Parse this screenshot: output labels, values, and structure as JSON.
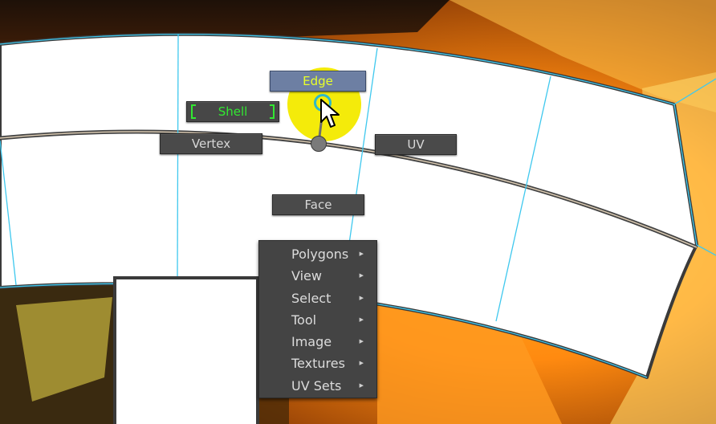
{
  "marking_menu": {
    "edge_label": "Edge",
    "shell_label": "Shell",
    "vertex_label": "Vertex",
    "uv_label": "UV",
    "face_label": "Face",
    "edge_text_color": "#e8ff2a",
    "shell_text_color": "#32e832"
  },
  "context_menu": {
    "items": [
      {
        "label": "Polygons",
        "submenu_icon": "triangle-right-icon"
      },
      {
        "label": "View",
        "submenu_icon": "triangle-right-icon"
      },
      {
        "label": "Select",
        "submenu_icon": "triangle-right-icon"
      },
      {
        "label": "Tool",
        "submenu_icon": "triangle-right-icon"
      },
      {
        "label": "Image",
        "submenu_icon": "triangle-right-icon"
      },
      {
        "label": "Textures",
        "submenu_icon": "triangle-right-icon"
      },
      {
        "label": "UV Sets",
        "submenu_icon": "triangle-right-icon"
      }
    ]
  },
  "colors": {
    "uv_edge_lines": "#3fc8ee",
    "cursor_highlight": "#f4ea00",
    "menu_background": "#444444"
  }
}
